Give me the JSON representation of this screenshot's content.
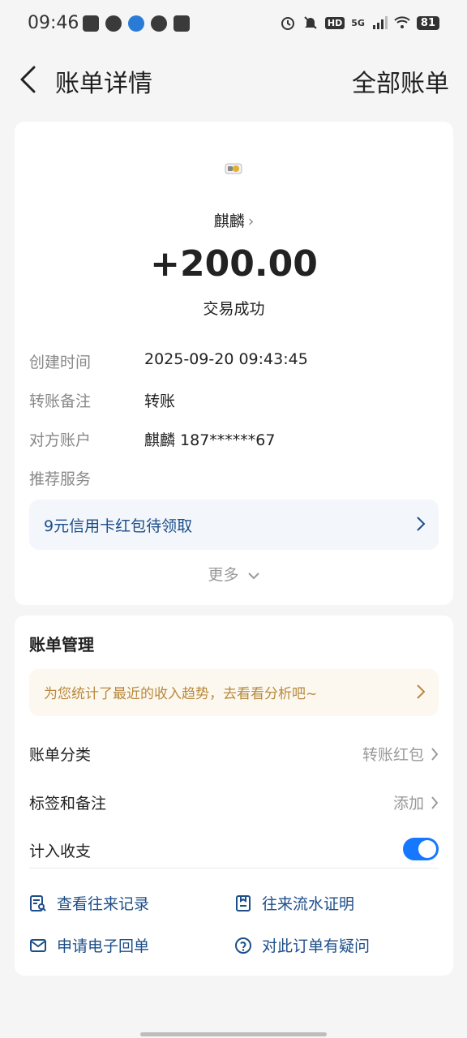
{
  "status_bar": {
    "time": "09:46",
    "network": "5G",
    "hd": "HD",
    "battery": "81",
    "left_icons": [
      "alipay-icon",
      "wechat-icon",
      "app-icon",
      "compass-icon",
      "calendar-icon"
    ],
    "right_icons": [
      "alarm-icon",
      "mute-icon",
      "hd-icon",
      "signal-icon",
      "wifi-icon",
      "battery-icon"
    ]
  },
  "nav": {
    "title": "账单详情",
    "right_label": "全部账单"
  },
  "transaction": {
    "payee": "麒麟",
    "amount": "+200.00",
    "status": "交易成功",
    "rows": [
      {
        "label": "创建时间",
        "value": "2025-09-20 09:43:45"
      },
      {
        "label": "转账备注",
        "value": "转账"
      },
      {
        "label": "对方账户",
        "value": "麒麟 187******67"
      },
      {
        "label": "推荐服务",
        "value": ""
      }
    ],
    "promo": "9元信用卡红包待领取",
    "more": "更多"
  },
  "management": {
    "title": "账单管理",
    "analysis": "为您统计了最近的收入趋势，去看看分析吧~",
    "category_label": "账单分类",
    "category_value": "转账红包",
    "tags_label": "标签和备注",
    "tags_value": "添加",
    "include_label": "计入收支",
    "include_on": true,
    "links": {
      "history": "查看往来记录",
      "flow_proof": "往来流水证明",
      "receipt": "申请电子回单",
      "question": "对此订单有疑问"
    }
  },
  "colors": {
    "accent": "#1677ff",
    "link": "#1d4e89",
    "promo_bg": "#f3f6fb",
    "analysis_bg": "#fdf8ef",
    "analysis_text": "#b8893e"
  }
}
